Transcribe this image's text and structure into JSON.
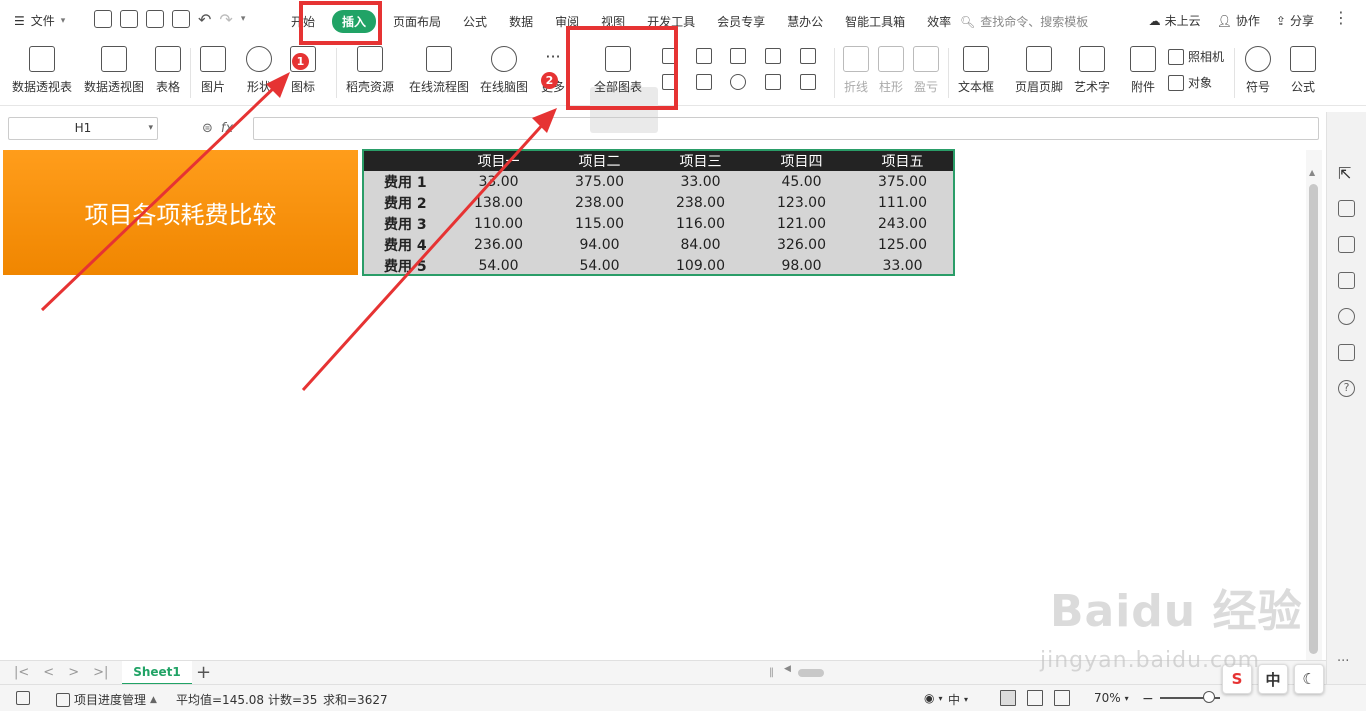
{
  "topbar": {
    "file_label": "文件",
    "tabs": [
      "开始",
      "插入",
      "页面布局",
      "公式",
      "数据",
      "审阅",
      "视图",
      "开发工具",
      "会员专享",
      "慧办公",
      "智能工具箱",
      "效率"
    ],
    "search_placeholder": "查找命令、搜索模板",
    "cloud_label": "未上云",
    "collab_label": "协作",
    "share_label": "分享"
  },
  "ribbon": {
    "pivot_table": "数据透视表",
    "pivot_chart": "数据透视图",
    "table": "表格",
    "picture": "图片",
    "shape": "形状",
    "icon": "图标",
    "daoke": "稻壳资源",
    "flowchart": "在线流程图",
    "mindmap": "在线脑图",
    "more": "更多",
    "all_charts": "全部图表",
    "spark_line": "折线",
    "spark_column": "柱形",
    "spark_winloss": "盈亏",
    "textbox": "文本框",
    "header_footer": "页眉页脚",
    "wordart": "艺术字",
    "attachment": "附件",
    "camera": "照相机",
    "object": "对象",
    "symbol": "符号",
    "formula": "公式"
  },
  "annotations": {
    "badge1": "1",
    "badge2": "2"
  },
  "formula_bar": {
    "cell_ref": "H1",
    "fx_label": "fx"
  },
  "sheet": {
    "title": "项目各项耗费比较",
    "table": {
      "headers": [
        "",
        "项目一",
        "项目二",
        "项目三",
        "项目四",
        "项目五"
      ],
      "rows": [
        [
          "费用 1",
          "33.00",
          "375.00",
          "33.00",
          "45.00",
          "375.00"
        ],
        [
          "费用 2",
          "138.00",
          "238.00",
          "238.00",
          "123.00",
          "111.00"
        ],
        [
          "费用 3",
          "110.00",
          "115.00",
          "116.00",
          "121.00",
          "243.00"
        ],
        [
          "费用 4",
          "236.00",
          "94.00",
          "84.00",
          "326.00",
          "125.00"
        ],
        [
          "费用 5",
          "54.00",
          "54.00",
          "109.00",
          "98.00",
          "33.00"
        ]
      ]
    }
  },
  "sheet_tabs": {
    "active": "Sheet1"
  },
  "status": {
    "project_label": "项目进度管理",
    "average": "平均值=145.08",
    "count": "计数=35",
    "sum": "求和=3627",
    "zoom": "70%"
  },
  "ime": {
    "middle": "中"
  },
  "watermark": {
    "logo": "Baidu 经验",
    "url": "jingyan.baidu.com"
  },
  "colors": {
    "accent": "#21a366",
    "annotation_red": "#e63333",
    "title_orange": "#ff9d1b"
  }
}
